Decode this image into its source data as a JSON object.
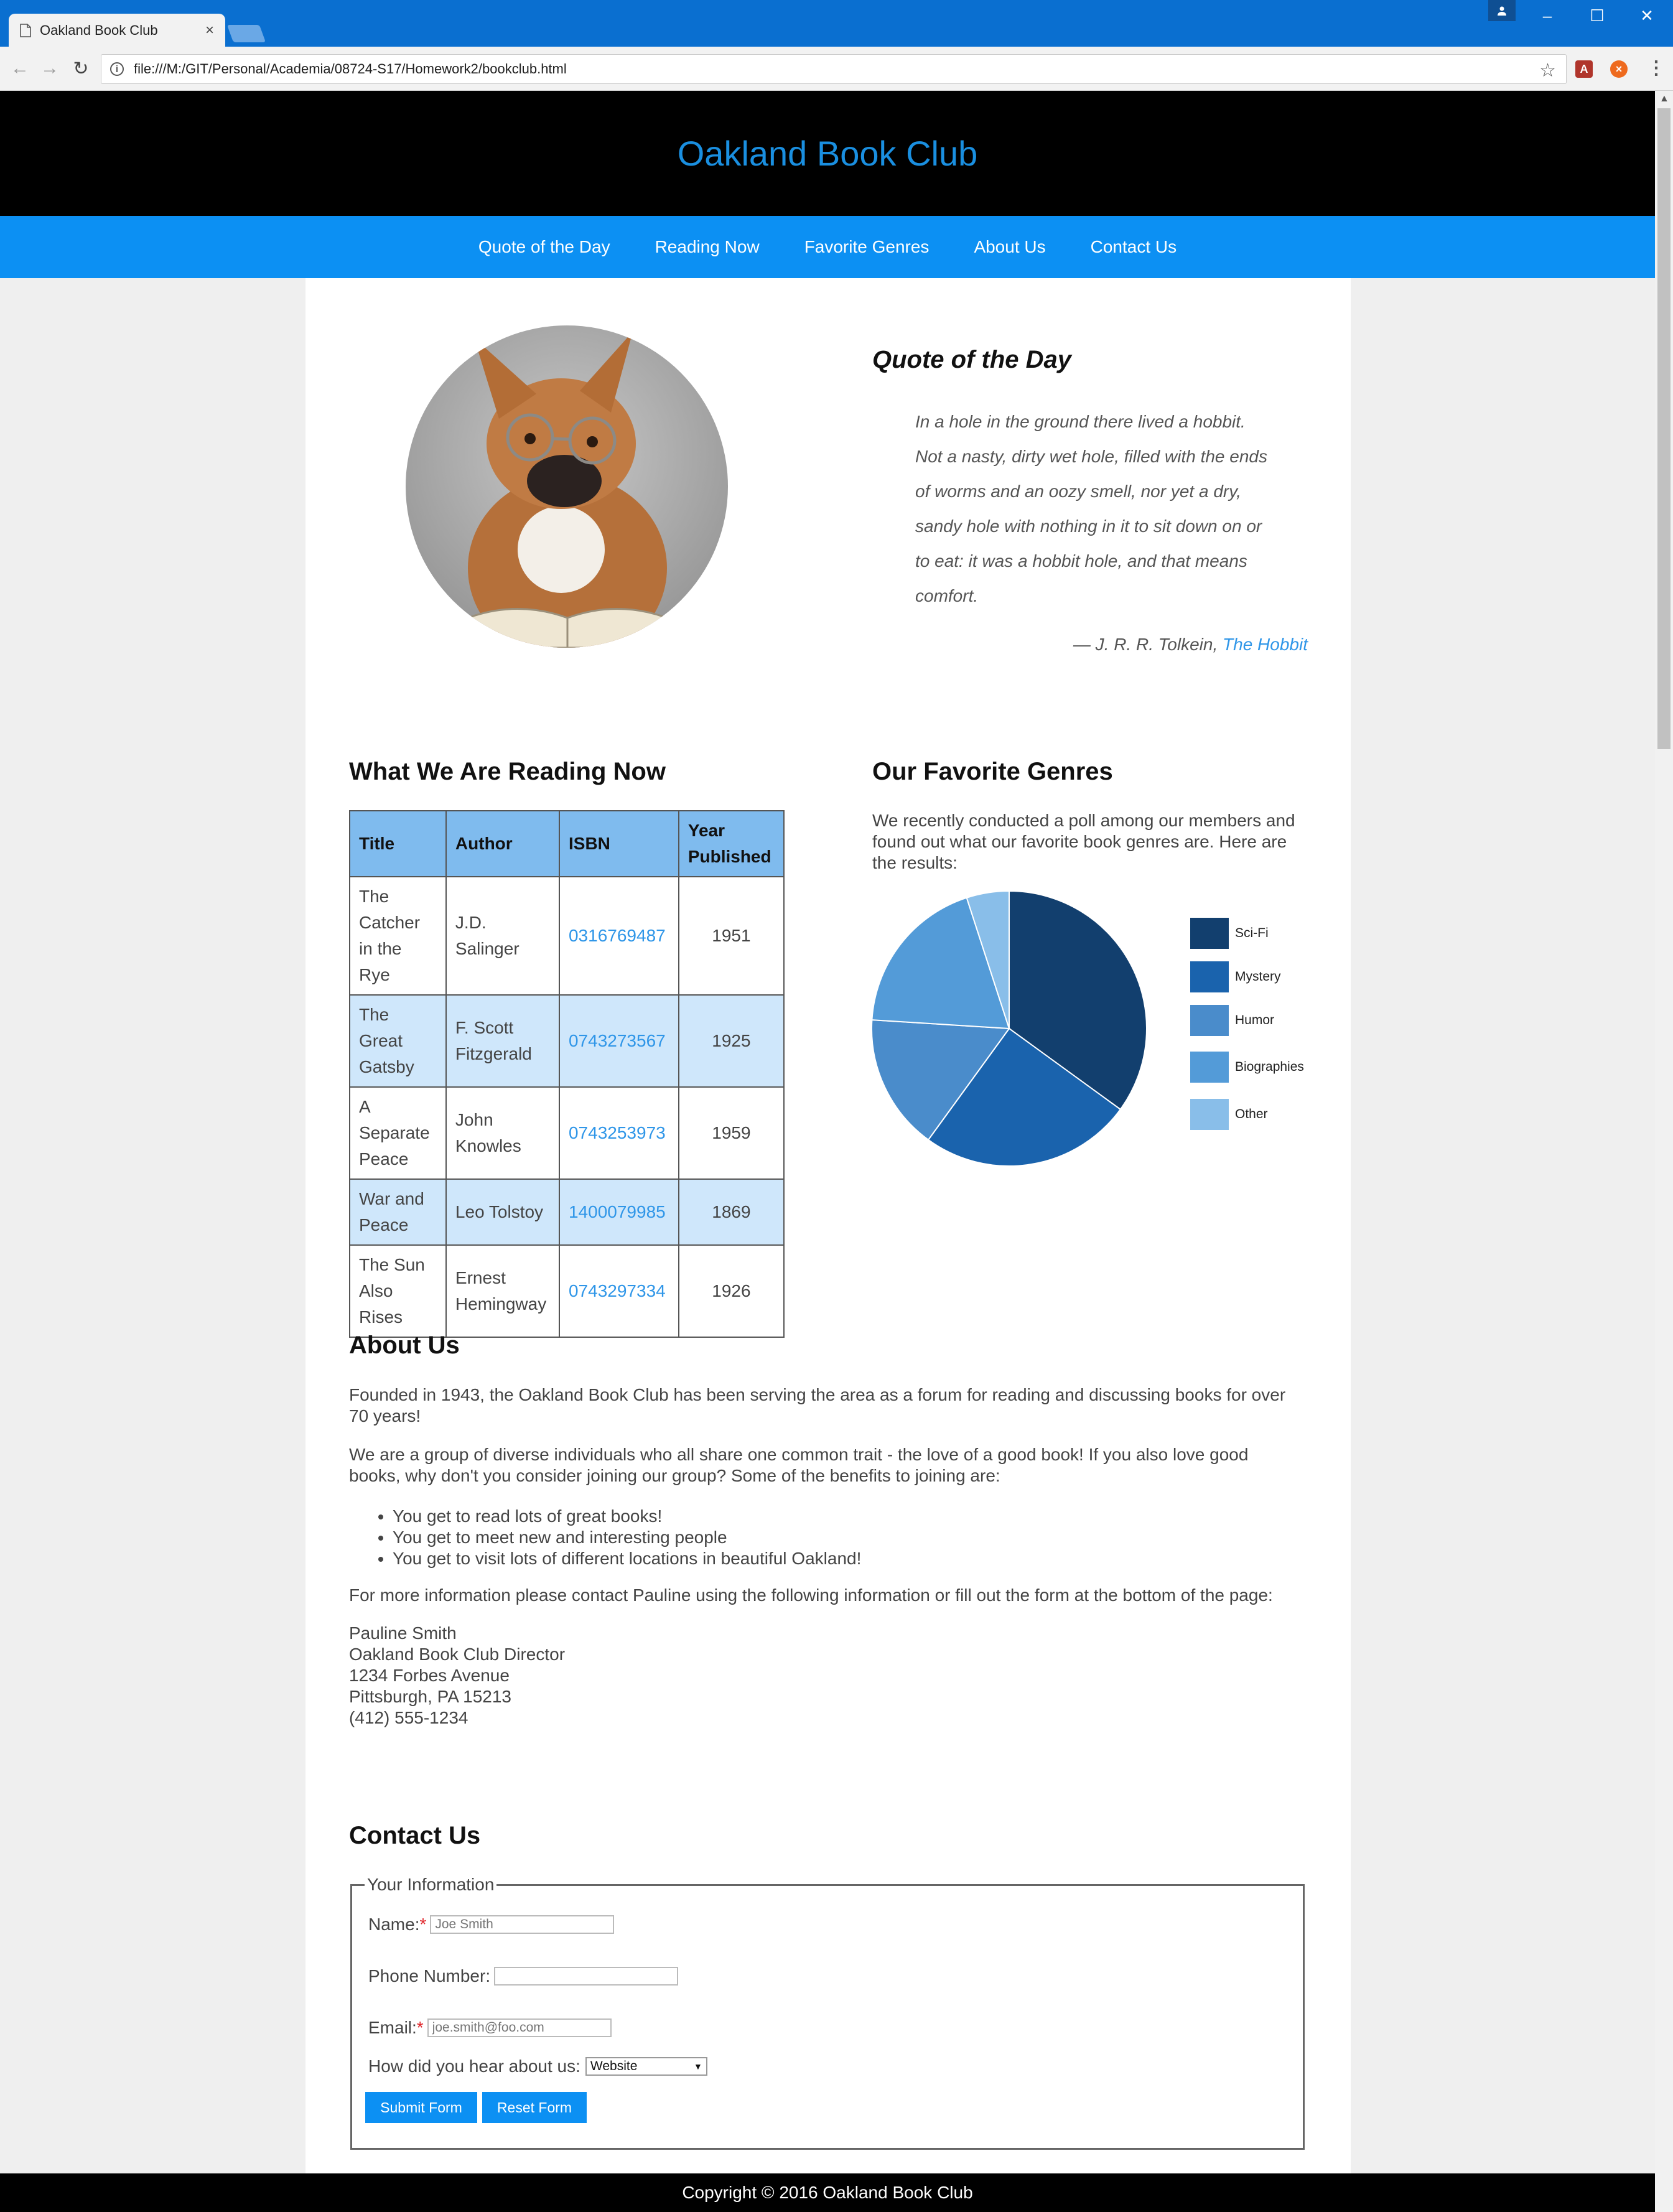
{
  "browser": {
    "tab_title": "Oakland Book Club",
    "url": "file:///M:/GIT/Personal/Academia/08724-S17/Homework2/bookclub.html"
  },
  "site": {
    "title": "Oakland Book Club",
    "nav": [
      "Quote of the Day",
      "Reading Now",
      "Favorite Genres",
      "About Us",
      "Contact Us"
    ]
  },
  "quote": {
    "heading": "Quote of the Day",
    "lines": [
      "In a hole in the ground there lived a hobbit.",
      "Not a nasty, dirty wet hole, filled with the ends",
      "of worms and an oozy smell, nor yet a dry,",
      "sandy hole with nothing in it to sit down on or",
      "to eat: it was a hobbit hole, and that means",
      "comfort."
    ],
    "attribution": "— J. R. R. Tolkein,",
    "book": "The Hobbit"
  },
  "reading": {
    "heading": "What We Are Reading Now",
    "columns": [
      "Title",
      "Author",
      "ISBN",
      "Year Published"
    ],
    "rows": [
      [
        "The Catcher in the Rye",
        "J.D. Salinger",
        "0316769487",
        "1951"
      ],
      [
        "The Great Gatsby",
        "F. Scott Fitzgerald",
        "0743273567",
        "1925"
      ],
      [
        "A Separate Peace",
        "John Knowles",
        "0743253973",
        "1959"
      ],
      [
        "War and Peace",
        "Leo Tolstoy",
        "1400079985",
        "1869"
      ],
      [
        "The Sun Also Rises",
        "Ernest Hemingway",
        "0743297334",
        "1926"
      ]
    ]
  },
  "genres": {
    "heading": "Our Favorite Genres",
    "text": "We recently conducted a poll among our members and found out what our favorite book genres are. Here are the results:"
  },
  "chart_data": {
    "type": "pie",
    "categories": [
      "Sci-Fi",
      "Mystery",
      "Humor",
      "Biographies",
      "Other"
    ],
    "values": [
      35,
      25,
      16,
      19,
      5
    ],
    "colors": [
      "#123f6e",
      "#1a63ad",
      "#4a8ccb",
      "#539bd8",
      "#89bee9"
    ],
    "legend": "right"
  },
  "about": {
    "heading": "About Us",
    "p1": "Founded in 1943, the Oakland Book Club has been serving the area as a forum for reading and discussing books for over 70 years!",
    "p2": "We are a group of diverse individuals who all share one common trait - the love of a good book! If you also love good books, why don't you consider joining our group? Some of the benefits to joining are:",
    "benefits": [
      "You get to read lots of great books!",
      "You get to meet new and interesting people",
      "You get to visit lots of different locations in beautiful Oakland!"
    ],
    "p3": "For more information please contact Pauline using the following information or fill out the form at the bottom of the page:",
    "contact_lines": [
      "Pauline Smith",
      "Oakland Book Club Director",
      "1234 Forbes Avenue",
      "Pittsburgh, PA 15213",
      "(412) 555-1234"
    ]
  },
  "contact": {
    "heading": "Contact Us",
    "legend": "Your Information",
    "name_label": "Name:",
    "name_placeholder": "Joe Smith",
    "phone_label": "Phone Number:",
    "email_label": "Email:",
    "email_placeholder": "joe.smith@foo.com",
    "hear_label": "How did you hear about us:",
    "hear_selected": "Website",
    "required_mark": "*",
    "submit_label": "Submit Form",
    "reset_label": "Reset Form"
  },
  "footer": {
    "text": "Copyright © 2016 Oakland Book Club"
  },
  "icons": {
    "page": "page-icon",
    "close": "close-icon",
    "back": "back-icon",
    "forward": "forward-icon",
    "reload": "reload-icon",
    "info": "info-icon",
    "star": "star-icon",
    "menu": "menu-icon"
  }
}
